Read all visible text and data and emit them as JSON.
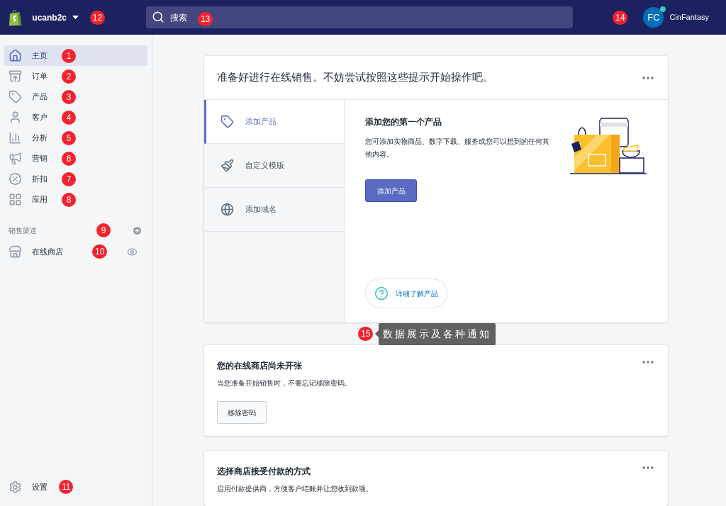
{
  "topbar": {
    "store_name": "ucanb2c",
    "store_badge": "12",
    "search": {
      "placeholder": "搜索",
      "badge": "13"
    },
    "user_badge": "14",
    "avatar": "FC",
    "user_name": "CinFantasy"
  },
  "sidebar": {
    "items": [
      {
        "label": "主页",
        "badge": "1",
        "selected": true
      },
      {
        "label": "订单",
        "badge": "2",
        "selected": false
      },
      {
        "label": "产品",
        "badge": "3",
        "selected": false
      },
      {
        "label": "客户",
        "badge": "4",
        "selected": false
      },
      {
        "label": "分析",
        "badge": "5",
        "selected": false
      },
      {
        "label": "营销",
        "badge": "6",
        "selected": false
      },
      {
        "label": "折扣",
        "badge": "7",
        "selected": false
      },
      {
        "label": "应用",
        "badge": "8",
        "selected": false
      }
    ],
    "channels_heading": "销售渠道",
    "channels_badge": "9",
    "channels": [
      {
        "label": "在线商店",
        "badge": "10"
      }
    ],
    "settings": {
      "label": "设置",
      "badge": "11"
    }
  },
  "setup_card": {
    "title": "准备好进行在线销售。不妨尝试按照这些提示开始操作吧。",
    "tabs": [
      {
        "label": "添加产品",
        "selected": true
      },
      {
        "label": "自定义模版",
        "selected": false
      },
      {
        "label": "添加域名",
        "selected": false
      }
    ],
    "panel": {
      "heading": "添加您的第一个产品",
      "text": "您可添加实物商品、数字下载、服务或您可以想到的任何其他内容。",
      "button": "添加产品",
      "help_link": "详细了解产品"
    }
  },
  "tooltip": {
    "badge": "15",
    "text": "数据展示及各种通知"
  },
  "cards": [
    {
      "title": "您的在线商店尚未开张",
      "text": "当您准备开始销售时，不要忘记移除密码。",
      "button": "移除密码"
    },
    {
      "title": "选择商店接受付款的方式",
      "text": "启用付款提供商，方便客户结账并让您收到款项。"
    }
  ]
}
